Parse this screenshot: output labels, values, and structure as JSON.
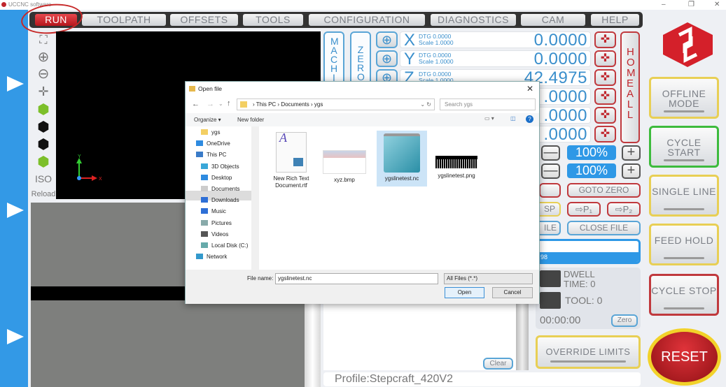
{
  "window": {
    "title": "UCCNC software",
    "controls": [
      "–",
      "❐",
      "✕"
    ]
  },
  "tabs": [
    "RUN",
    "TOOLPATH",
    "OFFSETS",
    "TOOLS",
    "CONFIGURATION",
    "DIAGNOSTICS",
    "CAM",
    "HELP"
  ],
  "tools": {
    "iso": "ISO",
    "reload": "Reload"
  },
  "viewer": {
    "axis_x": "X",
    "axis_y": "Y"
  },
  "dro": {
    "machine": "MACHINE",
    "zero": "ZERO",
    "axes": [
      {
        "axis": "X",
        "dtg": "DTG  0.0000",
        "scale": "Scale 1.0000",
        "value": "0.0000"
      },
      {
        "axis": "Y",
        "dtg": "DTG  0.0000",
        "scale": "Scale 1.0000",
        "value": "0.0000"
      },
      {
        "axis": "Z",
        "dtg": "DTG  0.0000",
        "scale": "Scale 1.0000",
        "value": "42.4975"
      },
      {
        "value": ".0000"
      },
      {
        "value": ".0000"
      },
      {
        "value": ".0000"
      }
    ],
    "home_all": "HOME ALL"
  },
  "right_buttons": {
    "offline": "OFFLINE MODE",
    "cycle_start": "CYCLE START",
    "single_line": "SINGLE LINE",
    "feed_hold": "FEED HOLD",
    "cycle_stop": "CYCLE STOP",
    "reset": "RESET"
  },
  "colors": {
    "accent_blue": "#2e98e6",
    "red": "#c0262d",
    "green": "#3dbb3d",
    "yellow": "#e8cf55"
  },
  "overrides": {
    "feed": "100%",
    "spindle": "100%",
    "minus": "—",
    "plus": "+"
  },
  "controls": {
    "goto_zero": "GOTO ZERO",
    "sp_partial": "SP",
    "p1": "⇨P₁",
    "p2": "⇨P₂",
    "file_partial": "ILE",
    "close_file": "CLOSE FILE"
  },
  "progress": {
    "text": "98"
  },
  "status": {
    "dwell": "DWELL",
    "time": "TIME: 0",
    "tool": "TOOL:  0",
    "timer": "00:00:00",
    "zero": "Zero"
  },
  "override_limits": "OVERRIDE LIMITS",
  "console": {
    "clear": "Clear"
  },
  "profile": "Profile:Stepcraft_420V2",
  "dialog": {
    "title": "Open file",
    "path": [
      "This PC",
      "Documents",
      "ygs"
    ],
    "search_placeholder": "Search ygs",
    "organize": "Organize ▾",
    "new_folder": "New folder",
    "nav": [
      "ygs",
      "OneDrive",
      "This PC",
      "3D Objects",
      "Desktop",
      "Documents",
      "Downloads",
      "Music",
      "Pictures",
      "Videos",
      "Local Disk (C:)",
      "Network"
    ],
    "files": [
      "New Rich Text Document.rtf",
      "xyz.bmp",
      "ygslinetest.nc",
      "ygslinetest.png"
    ],
    "file_name_label": "File name:",
    "file_name": "ygslinetest.nc",
    "filter": "All Files (*.*)",
    "open": "Open",
    "cancel": "Cancel"
  }
}
